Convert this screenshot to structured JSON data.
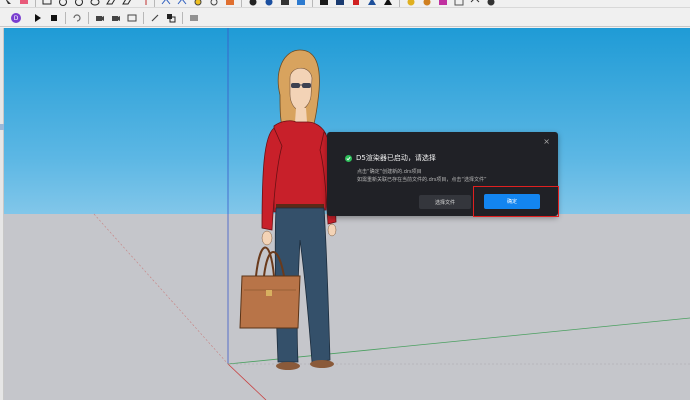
{
  "toolbar": {
    "row1_icons": [
      "select-icon",
      "eraser-icon",
      "rectangle-icon",
      "circle-icon",
      "polygon-icon",
      "arc-icon",
      "pushpull-icon",
      "move-icon",
      "rotate-icon",
      "scale-icon",
      "offset-icon",
      "tape-icon",
      "text-icon",
      "paint-icon",
      "orbit-icon",
      "pan-icon",
      "zoom-icon",
      "zoom-extents-icon",
      "warehouse-icon",
      "extension-icon",
      "layers-icon",
      "styles-icon",
      "render-icon",
      "shadow-icon",
      "fog-icon",
      "section-icon",
      "sandbox-icon",
      "ruby-icon",
      "settings-icon"
    ],
    "row2_icons": [
      "d5-logo-icon",
      "play-icon",
      "stop-icon",
      "sync-icon",
      "camera-add-icon",
      "camera-remove-icon",
      "scene-icon",
      "link-icon",
      "material-icon",
      "settings-list-icon"
    ]
  },
  "dialog": {
    "title": "D5渲染器已启动，请选择",
    "line1": "点击“确定”创建新的.drs项目",
    "line2": "如需重新关联已存在当前文件的.drs项目，点击“选择文件”",
    "choose_file_label": "选择文件",
    "ok_label": "确定",
    "close_glyph": "×"
  },
  "colors": {
    "dialog_bg": "#202126",
    "ok_button": "#1385f0",
    "success_check": "#2dbf5a",
    "highlight": "#e02020",
    "sky_top": "#1f9bd6",
    "ground": "#c5c6cb"
  }
}
